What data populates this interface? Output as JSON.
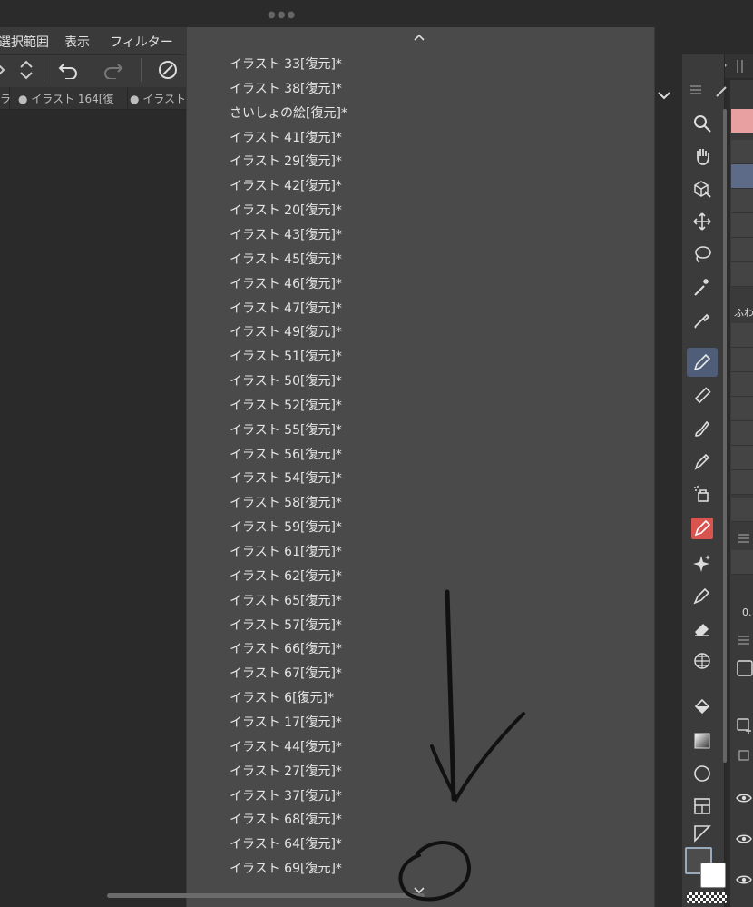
{
  "menu": {
    "items": [
      "選択範囲",
      "表示",
      "フィルター"
    ]
  },
  "tabs": [
    {
      "label": "ラ"
    },
    {
      "label": "● イラスト 164[復"
    },
    {
      "label": "● イラスト"
    }
  ],
  "dropdown": {
    "items": [
      "イラスト 33[復元]*",
      "イラスト 38[復元]*",
      "さいしょの絵[復元]*",
      "イラスト 41[復元]*",
      "イラスト 29[復元]*",
      "イラスト 42[復元]*",
      "イラスト 20[復元]*",
      "イラスト 43[復元]*",
      "イラスト 45[復元]*",
      "イラスト 46[復元]*",
      "イラスト 47[復元]*",
      "イラスト 49[復元]*",
      "イラスト 51[復元]*",
      "イラスト 50[復元]*",
      "イラスト 52[復元]*",
      "イラスト 55[復元]*",
      "イラスト 56[復元]*",
      "イラスト 54[復元]*",
      "イラスト 58[復元]*",
      "イラスト 59[復元]*",
      "イラスト 61[復元]*",
      "イラスト 62[復元]*",
      "イラスト 65[復元]*",
      "イラスト 57[復元]*",
      "イラスト 66[復元]*",
      "イラスト 67[復元]*",
      "イラスト 6[復元]*",
      "イラスト 17[復元]*",
      "イラスト 44[復元]*",
      "イラスト 27[復元]*",
      "イラスト 37[復元]*",
      "イラスト 68[復元]*",
      "イラスト 64[復元]*",
      "イラスト 69[復元]*"
    ]
  },
  "side_labels": {
    "brush_group": "ふわ",
    "size_value": "0."
  },
  "colors": {
    "accent_active": "#4f5d78",
    "dropdown_bg": "#4a4a4a",
    "main_color": "#4c4c4c",
    "sub_color": "#ffffff",
    "red_tool": "#d9534f"
  },
  "icons": {
    "tools": [
      "zoom-icon",
      "hand-icon",
      "object-icon",
      "move-icon",
      "lasso-icon",
      "magic-wand-icon",
      "eyedropper-icon",
      "pen-icon",
      "pencil-icon",
      "brush-icon",
      "marker-icon",
      "airbrush-icon",
      "red-brush-icon",
      "sparkle-icon",
      "blend-icon",
      "eraser-icon",
      "ruler-icon",
      "fill-icon",
      "gradient-icon",
      "shape-icon",
      "frame-icon",
      "text-icon"
    ]
  }
}
